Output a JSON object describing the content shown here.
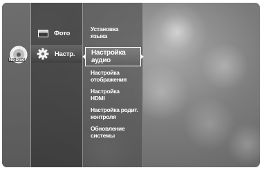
{
  "left_column": {
    "disc_label": "No Disc",
    "disc_icon": "disc-icon"
  },
  "middle_column": {
    "items": [
      {
        "label": "Фото",
        "icon": "photo-icon"
      },
      {
        "label": "Настр.",
        "icon": "gear-icon",
        "selected": true
      }
    ]
  },
  "right_column": {
    "items": [
      {
        "label_line1": "Установка",
        "label_line2": "языка"
      },
      {
        "label_line1": "Настройка",
        "label_line2": "аудио",
        "selected": true
      },
      {
        "label_line1": "Настройка",
        "label_line2": "отображения"
      },
      {
        "label_line1": "Настройка",
        "label_line2": "HDMI"
      },
      {
        "label_line1": "Настройка родит.",
        "label_line2": "контроля"
      },
      {
        "label_line1": "Обновление",
        "label_line2": "системы"
      }
    ]
  },
  "colors": {
    "text": "#ffffff",
    "highlight_border": "#ffffff"
  }
}
